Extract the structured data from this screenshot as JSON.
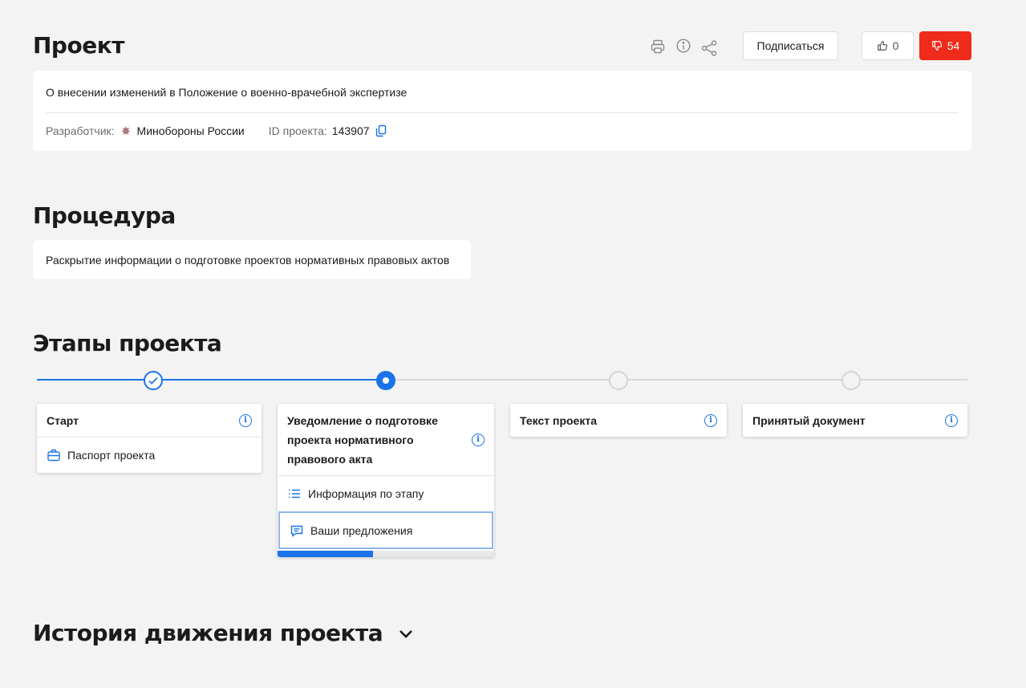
{
  "project": {
    "heading": "Проект",
    "subscribe_label": "Подписаться",
    "likes": "0",
    "dislikes": "54",
    "description": "О внесении изменений в Положение о военно-врачебной экспертизе",
    "developer_label": "Разработчик:",
    "developer_name": "Минобороны России",
    "id_label": "ID проекта:",
    "id_value": "143907"
  },
  "procedure": {
    "heading": "Процедура",
    "text": "Раскрытие информации о подготовке проектов нормативных правовых актов"
  },
  "stages": {
    "heading": "Этапы проекта",
    "items": [
      {
        "title": "Старт",
        "state": "done",
        "rows": [
          "Паспорт проекта"
        ]
      },
      {
        "title": "Уведомление о подготовке проекта нормативного правового акта",
        "state": "current",
        "rows": [
          "Информация по этапу",
          "Ваши предложения"
        ],
        "progress": 0.44
      },
      {
        "title": "Текст проекта",
        "state": "pending",
        "rows": []
      },
      {
        "title": "Принятый документ",
        "state": "pending",
        "rows": []
      }
    ]
  },
  "history": {
    "heading": "История движения проекта"
  },
  "colors": {
    "accent": "#1a73e8",
    "dislike_bg": "#ef2b1b",
    "background": "#f3f3f3"
  },
  "icons": [
    "print-icon",
    "info-icon",
    "share-icon",
    "thumb-up-icon",
    "thumb-down-icon",
    "emblem-icon",
    "copy-icon",
    "check-icon",
    "briefcase-icon",
    "list-icon",
    "comment-icon",
    "chevron-down-icon"
  ]
}
